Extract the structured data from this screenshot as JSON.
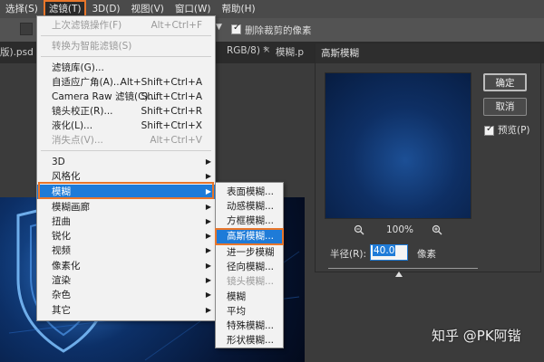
{
  "menubar": {
    "items": [
      "选择(S)",
      "滤镜(T)",
      "3D(D)",
      "视图(V)",
      "窗口(W)",
      "帮助(H)"
    ]
  },
  "options_bar": {
    "checkbox_label": "删除裁剪的像素"
  },
  "tabs": {
    "left": "版).psd",
    "center": "RGB/8) *",
    "right": "模糊.p"
  },
  "filter_menu": {
    "items": [
      {
        "label": "上次滤镜操作(F)",
        "shortcut": "Alt+Ctrl+F",
        "disabled": true
      },
      {
        "label": "转换为智能滤镜(S)",
        "shortcut": "",
        "disabled": true
      },
      {
        "label": "滤镜库(G)...",
        "shortcut": ""
      },
      {
        "label": "自适应广角(A)...",
        "shortcut": "Alt+Shift+Ctrl+A"
      },
      {
        "label": "Camera Raw 滤镜(C)...",
        "shortcut": "Shift+Ctrl+A"
      },
      {
        "label": "镜头校正(R)...",
        "shortcut": "Shift+Ctrl+R"
      },
      {
        "label": "液化(L)...",
        "shortcut": "Shift+Ctrl+X"
      },
      {
        "label": "消失点(V)...",
        "shortcut": "Alt+Ctrl+V",
        "disabled": true
      },
      {
        "label": "3D",
        "shortcut": ""
      },
      {
        "label": "风格化",
        "shortcut": ""
      },
      {
        "label": "模糊",
        "shortcut": ""
      },
      {
        "label": "模糊画廊",
        "shortcut": ""
      },
      {
        "label": "扭曲",
        "shortcut": ""
      },
      {
        "label": "锐化",
        "shortcut": ""
      },
      {
        "label": "视频",
        "shortcut": ""
      },
      {
        "label": "像素化",
        "shortcut": ""
      },
      {
        "label": "渲染",
        "shortcut": ""
      },
      {
        "label": "杂色",
        "shortcut": ""
      },
      {
        "label": "其它",
        "shortcut": ""
      }
    ]
  },
  "blur_submenu": {
    "items": [
      "表面模糊...",
      "动感模糊...",
      "方框模糊...",
      "高斯模糊...",
      "进一步模糊",
      "径向模糊...",
      "镜头模糊...",
      "模糊",
      "平均",
      "特殊模糊...",
      "形状模糊..."
    ]
  },
  "dialog": {
    "title": "高斯模糊",
    "ok_label": "确定",
    "cancel_label": "取消",
    "preview_label": "预览(P)",
    "zoom_level": "100%",
    "zoom_out_icon": "zoom-out-icon",
    "zoom_in_icon": "zoom-in-icon",
    "radius_label": "半径(R):",
    "radius_value": "40.0",
    "radius_unit": "像素"
  },
  "watermark": "知乎 @PK阿锴",
  "colors": {
    "highlight": "#1e7bd8",
    "annotation_box": "#e8762b"
  }
}
